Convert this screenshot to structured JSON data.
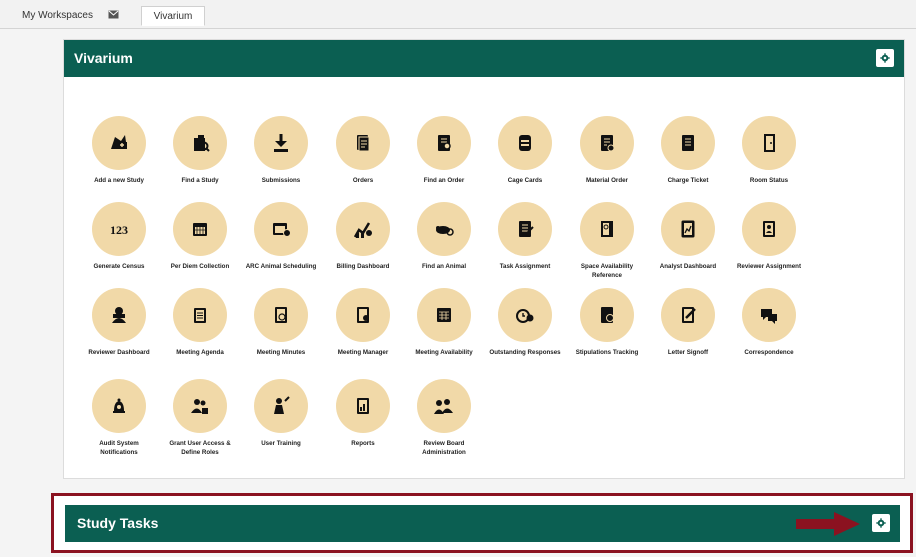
{
  "workspace_tabs": {
    "my_workspaces": "My Workspaces",
    "vivarium": "Vivarium"
  },
  "panel": {
    "title": "Vivarium"
  },
  "tiles": [
    {
      "label": "Add a new Study",
      "icon": "add-study-icon"
    },
    {
      "label": "Find a Study",
      "icon": "find-study-icon"
    },
    {
      "label": "Submissions",
      "icon": "download-icon"
    },
    {
      "label": "Orders",
      "icon": "orders-icon"
    },
    {
      "label": "Find an Order",
      "icon": "find-order-icon"
    },
    {
      "label": "Cage Cards",
      "icon": "cage-cards-icon"
    },
    {
      "label": "Material Order",
      "icon": "material-order-icon"
    },
    {
      "label": "Charge Ticket",
      "icon": "charge-ticket-icon"
    },
    {
      "label": "Room Status",
      "icon": "door-icon"
    },
    {
      "label": "Generate Census",
      "icon": "census-123-icon"
    },
    {
      "label": "Per Diem Collection",
      "icon": "calendar-icon"
    },
    {
      "label": "ARC Animal Scheduling",
      "icon": "scheduling-icon"
    },
    {
      "label": "Billing Dashboard",
      "icon": "billing-dashboard-icon"
    },
    {
      "label": "Find an Animal",
      "icon": "animal-search-icon"
    },
    {
      "label": "Task Assignment",
      "icon": "task-assignment-icon"
    },
    {
      "label": "Space Availability Reference",
      "icon": "space-availability-icon"
    },
    {
      "label": "Analyst Dashboard",
      "icon": "analyst-dashboard-icon"
    },
    {
      "label": "Reviewer Assignment",
      "icon": "reviewer-assignment-icon"
    },
    {
      "label": "Reviewer Dashboard",
      "icon": "reviewer-dashboard-icon"
    },
    {
      "label": "Meeting Agenda",
      "icon": "clipboard-icon"
    },
    {
      "label": "Meeting Minutes",
      "icon": "meeting-minutes-icon"
    },
    {
      "label": "Meeting Manager",
      "icon": "meeting-manager-icon"
    },
    {
      "label": "Meeting Availability",
      "icon": "meeting-availability-icon"
    },
    {
      "label": "Outstanding Responses",
      "icon": "alarm-clock-icon"
    },
    {
      "label": "Stipulations Tracking",
      "icon": "stipulations-icon"
    },
    {
      "label": "Letter Signoff",
      "icon": "signoff-icon"
    },
    {
      "label": "Correspondence",
      "icon": "chat-bubbles-icon"
    },
    {
      "label": "Audit System Notifications",
      "icon": "bell-icon"
    },
    {
      "label": "Grant User Access & Define Roles",
      "icon": "user-lock-icon"
    },
    {
      "label": "User Training",
      "icon": "user-training-icon"
    },
    {
      "label": "Reports",
      "icon": "reports-icon"
    },
    {
      "label": "Review Board Administration",
      "icon": "review-board-icon"
    }
  ],
  "study_tasks": {
    "title": "Study Tasks"
  },
  "colors": {
    "header_green": "#0b5f52",
    "icon_circle": "#f1d9a8",
    "highlight_red": "#8b1220"
  }
}
